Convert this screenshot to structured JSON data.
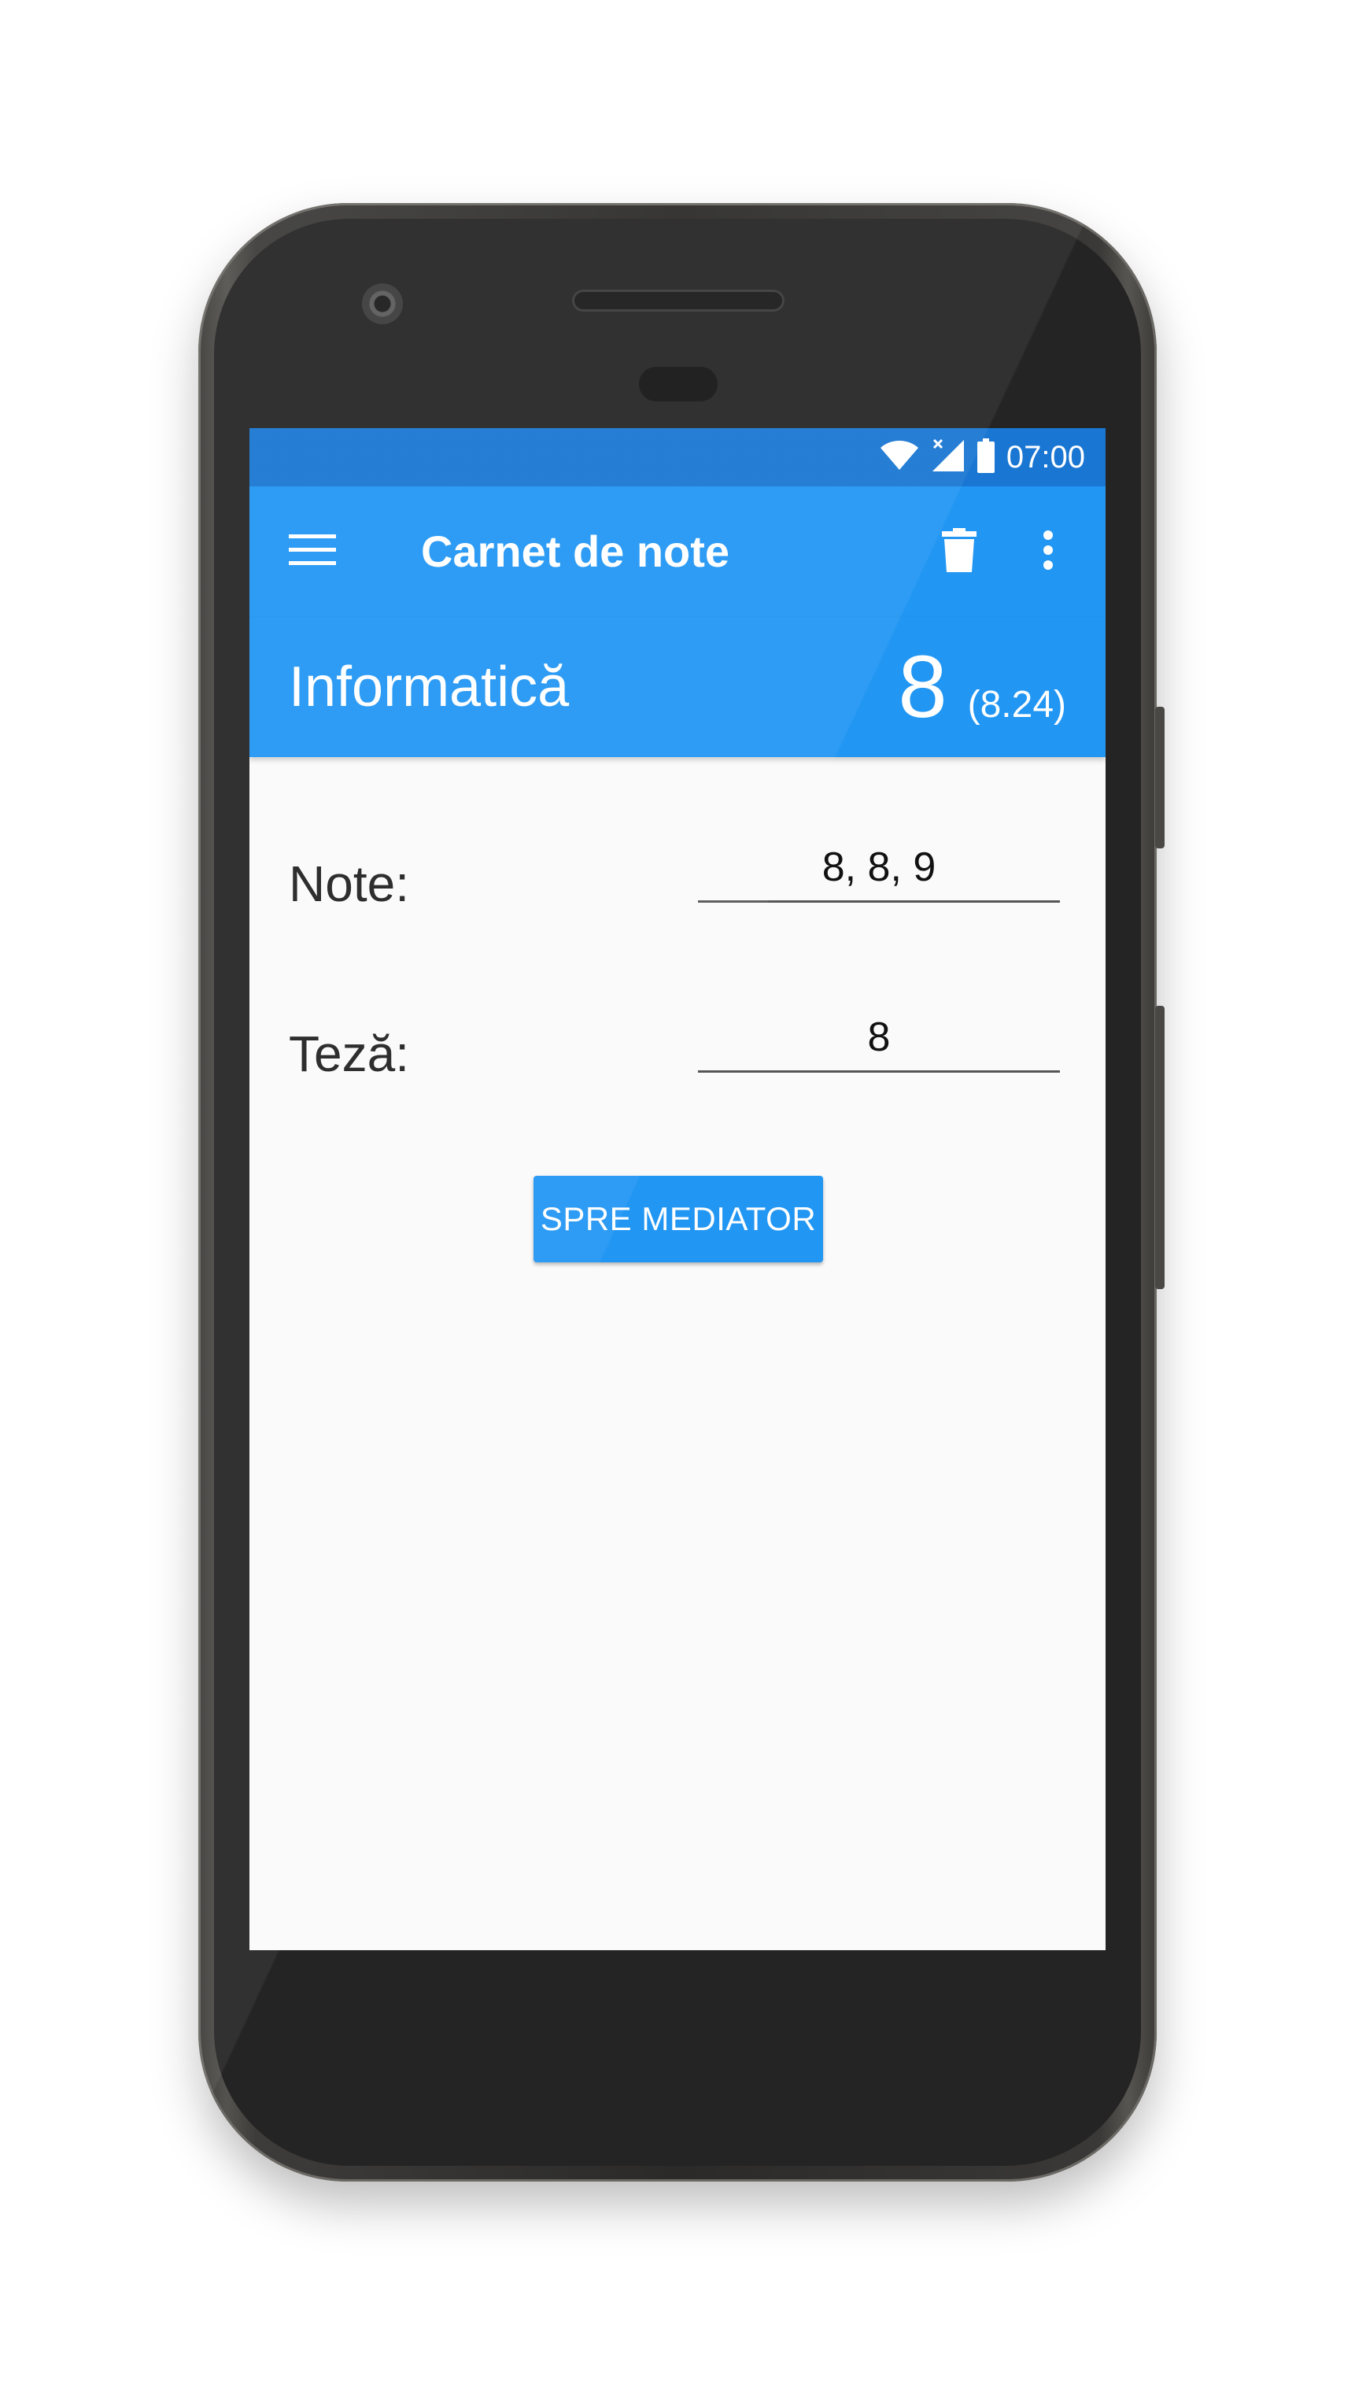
{
  "status_bar": {
    "time": "07:00",
    "icons": [
      "wifi-icon",
      "signal-no-data-icon",
      "battery-icon"
    ]
  },
  "app_bar": {
    "title": "Carnet de note",
    "menu_icon": "hamburger-menu-icon",
    "delete_icon": "trash-icon",
    "overflow_icon": "more-vertical-icon"
  },
  "header": {
    "subject": "Informatică",
    "final_grade": "8",
    "average": "(8.24)"
  },
  "form": {
    "grades_label": "Note:",
    "grades_value": "8, 8, 9",
    "thesis_label": "Teză:",
    "thesis_value": "8",
    "submit_label": "SPRE MEDIATOR"
  },
  "colors": {
    "primary": "#2196f3",
    "primary_dark": "#1976d2",
    "background": "#fafafa"
  }
}
